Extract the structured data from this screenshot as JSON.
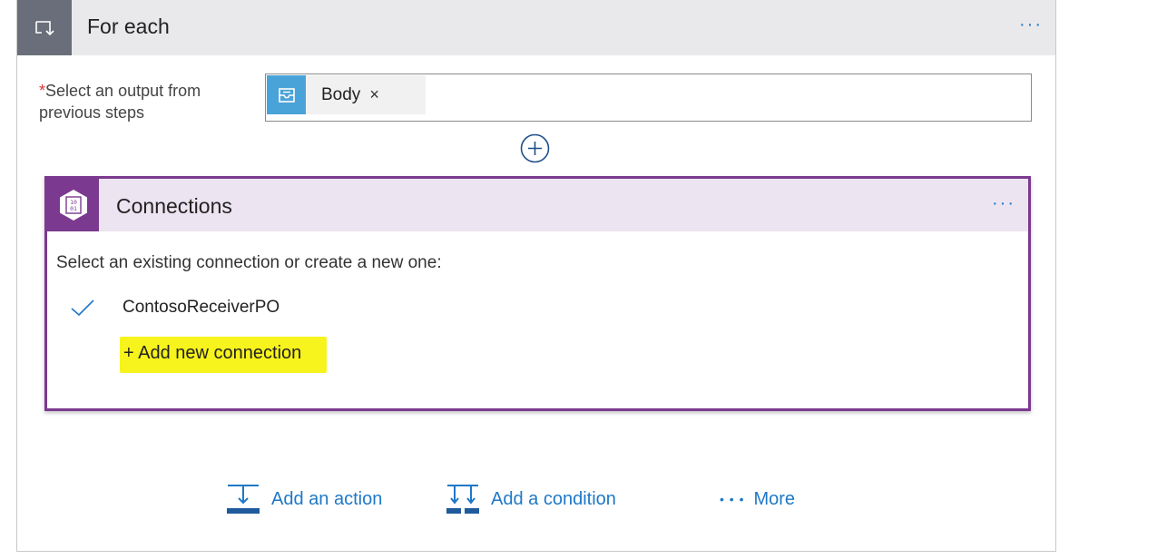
{
  "foreach": {
    "title": "For each",
    "more_dots": "···",
    "field_required_mark": "*",
    "field_label": "Select an output from previous steps",
    "token": {
      "label": "Body",
      "close": "×",
      "icon": "mail-token-icon"
    },
    "add_icon": "plus-circle-icon"
  },
  "connections": {
    "title": "Connections",
    "more_dots": "···",
    "prompt": "Select an existing connection or create a new one:",
    "items": [
      {
        "name": "ContosoReceiverPO",
        "selected": true
      }
    ],
    "add_new_label": "+ Add new connection",
    "highlight_color": "#f7f31c",
    "accent_color": "#7b3a8f"
  },
  "footer": {
    "add_action": "Add an action",
    "add_condition": "Add a condition",
    "more_dots": "• • •",
    "more": "More"
  },
  "colors": {
    "link": "#1e78c8",
    "foreach_icon_bg": "#6a6e7a",
    "token_icon_bg": "#4aa3d8"
  }
}
